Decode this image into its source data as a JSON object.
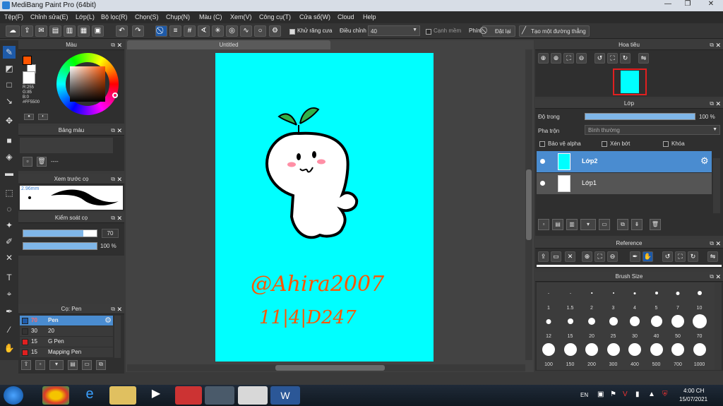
{
  "window": {
    "title": "MediBang Paint Pro (64bit)"
  },
  "menu": [
    "Tệp(F)",
    "Chỉnh sửa(E)",
    "Lớp(L)",
    "Bộ lọc(R)",
    "Chọn(S)",
    "Chụp(N)",
    "Màu (C)",
    "Xem(V)",
    "Công cụ(T)",
    "Cửa số(W)",
    "Cloud",
    "Help"
  ],
  "toolbar": {
    "antialias_label": "Khử răng cưa",
    "adjust_label": "Điều chỉnh",
    "adjust_value": "40",
    "snap_label": "Cạnh mềm",
    "key_label": "Phím",
    "reset_label": "Đặt lại",
    "create_line_label": "Tạo một đường thẳng"
  },
  "color_panel": {
    "title": "Màu",
    "r": "R:255",
    "g": "G:85",
    "b": "B:0",
    "hex": "#FF5500",
    "primary": "#ff5500",
    "secondary": "#ffffff"
  },
  "palette_panel": {
    "title": "Bảng màu",
    "dash": "----"
  },
  "brush_preview": {
    "title": "Xem trước cọ",
    "size": "2.96mm"
  },
  "brush_control": {
    "title": "Kiểm soát cọ",
    "size_value": "70",
    "opacity_value": "100 %",
    "size_fraction": 0.82,
    "opacity_fraction": 1.0
  },
  "brush_list": {
    "title": "Cọ: Pen",
    "items": [
      {
        "size": "70",
        "name": "Pen",
        "color": "#1e5aa8",
        "selected": true
      },
      {
        "size": "30",
        "name": "20",
        "color": "#333333",
        "selected": false
      },
      {
        "size": "15",
        "name": "G Pen",
        "color": "#e02020",
        "selected": false
      },
      {
        "size": "15",
        "name": "Mapping Pen",
        "color": "#e02020",
        "selected": false
      }
    ]
  },
  "canvas": {
    "tab_title": "Untitled",
    "signature_line1": "@Ahira2007",
    "signature_line2": "11|4|D247"
  },
  "navigator": {
    "title": "Hoa tiêu"
  },
  "layer_panel": {
    "title": "Lớp",
    "opacity_label": "Độ trong",
    "opacity_value": "100 %",
    "opacity_fraction": 1.0,
    "blend_label": "Pha trộn",
    "blend_value": "Bình thường",
    "protect_alpha": "Bảo vệ alpha",
    "clip": "Xén bớt",
    "lock": "Khóa",
    "layers": [
      {
        "name": "Lớp2",
        "selected": true
      },
      {
        "name": "Lớp1",
        "selected": false
      }
    ]
  },
  "reference_panel": {
    "title": "Reference"
  },
  "brush_size_panel": {
    "title": "Brush Size",
    "sizes": [
      "1",
      "1.5",
      "2",
      "3",
      "4",
      "5",
      "7",
      "10",
      "12",
      "15",
      "20",
      "25",
      "30",
      "40",
      "50",
      "70",
      "100",
      "150",
      "200",
      "300",
      "400",
      "500",
      "700",
      "1000"
    ]
  },
  "taskbar": {
    "lang": "EN",
    "time": "4:00 CH",
    "date": "15/07/2021"
  }
}
